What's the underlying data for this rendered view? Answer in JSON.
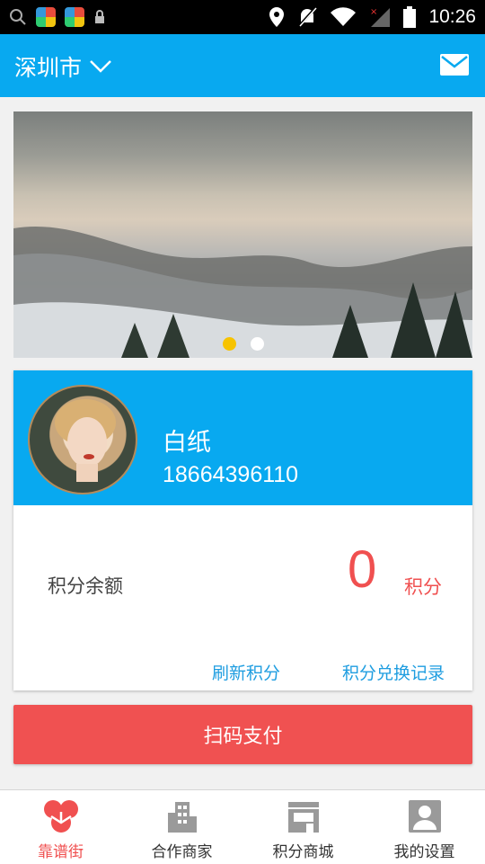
{
  "status_bar": {
    "time": "10:26",
    "icons": [
      "search-icon",
      "app-icon",
      "app-icon",
      "lock-icon",
      "location-icon",
      "mute-icon",
      "wifi-icon",
      "signal-icon",
      "battery-icon"
    ]
  },
  "header": {
    "city": "深圳市",
    "city_icon": "chevron-down-icon",
    "message_icon": "mail-icon"
  },
  "banner": {
    "slide_count": 2,
    "active_slide": 1
  },
  "profile": {
    "name": "白纸",
    "phone": "18664396110"
  },
  "points": {
    "label": "积分余额",
    "value": "0",
    "unit": "积分",
    "refresh_label": "刷新积分",
    "history_label": "积分兑换记录"
  },
  "actions": {
    "pay_label": "扫码支付"
  },
  "bottom_nav": {
    "items": [
      {
        "label": "靠谱街",
        "icon": "home-logo-icon",
        "active": true
      },
      {
        "label": "合作商家",
        "icon": "building-icon",
        "active": false
      },
      {
        "label": "积分商城",
        "icon": "store-icon",
        "active": false
      },
      {
        "label": "我的设置",
        "icon": "user-icon",
        "active": false
      }
    ]
  },
  "colors": {
    "primary": "#08a9f0",
    "accent": "#f05050",
    "link": "#1e9de0",
    "dot_active": "#f7c300"
  }
}
